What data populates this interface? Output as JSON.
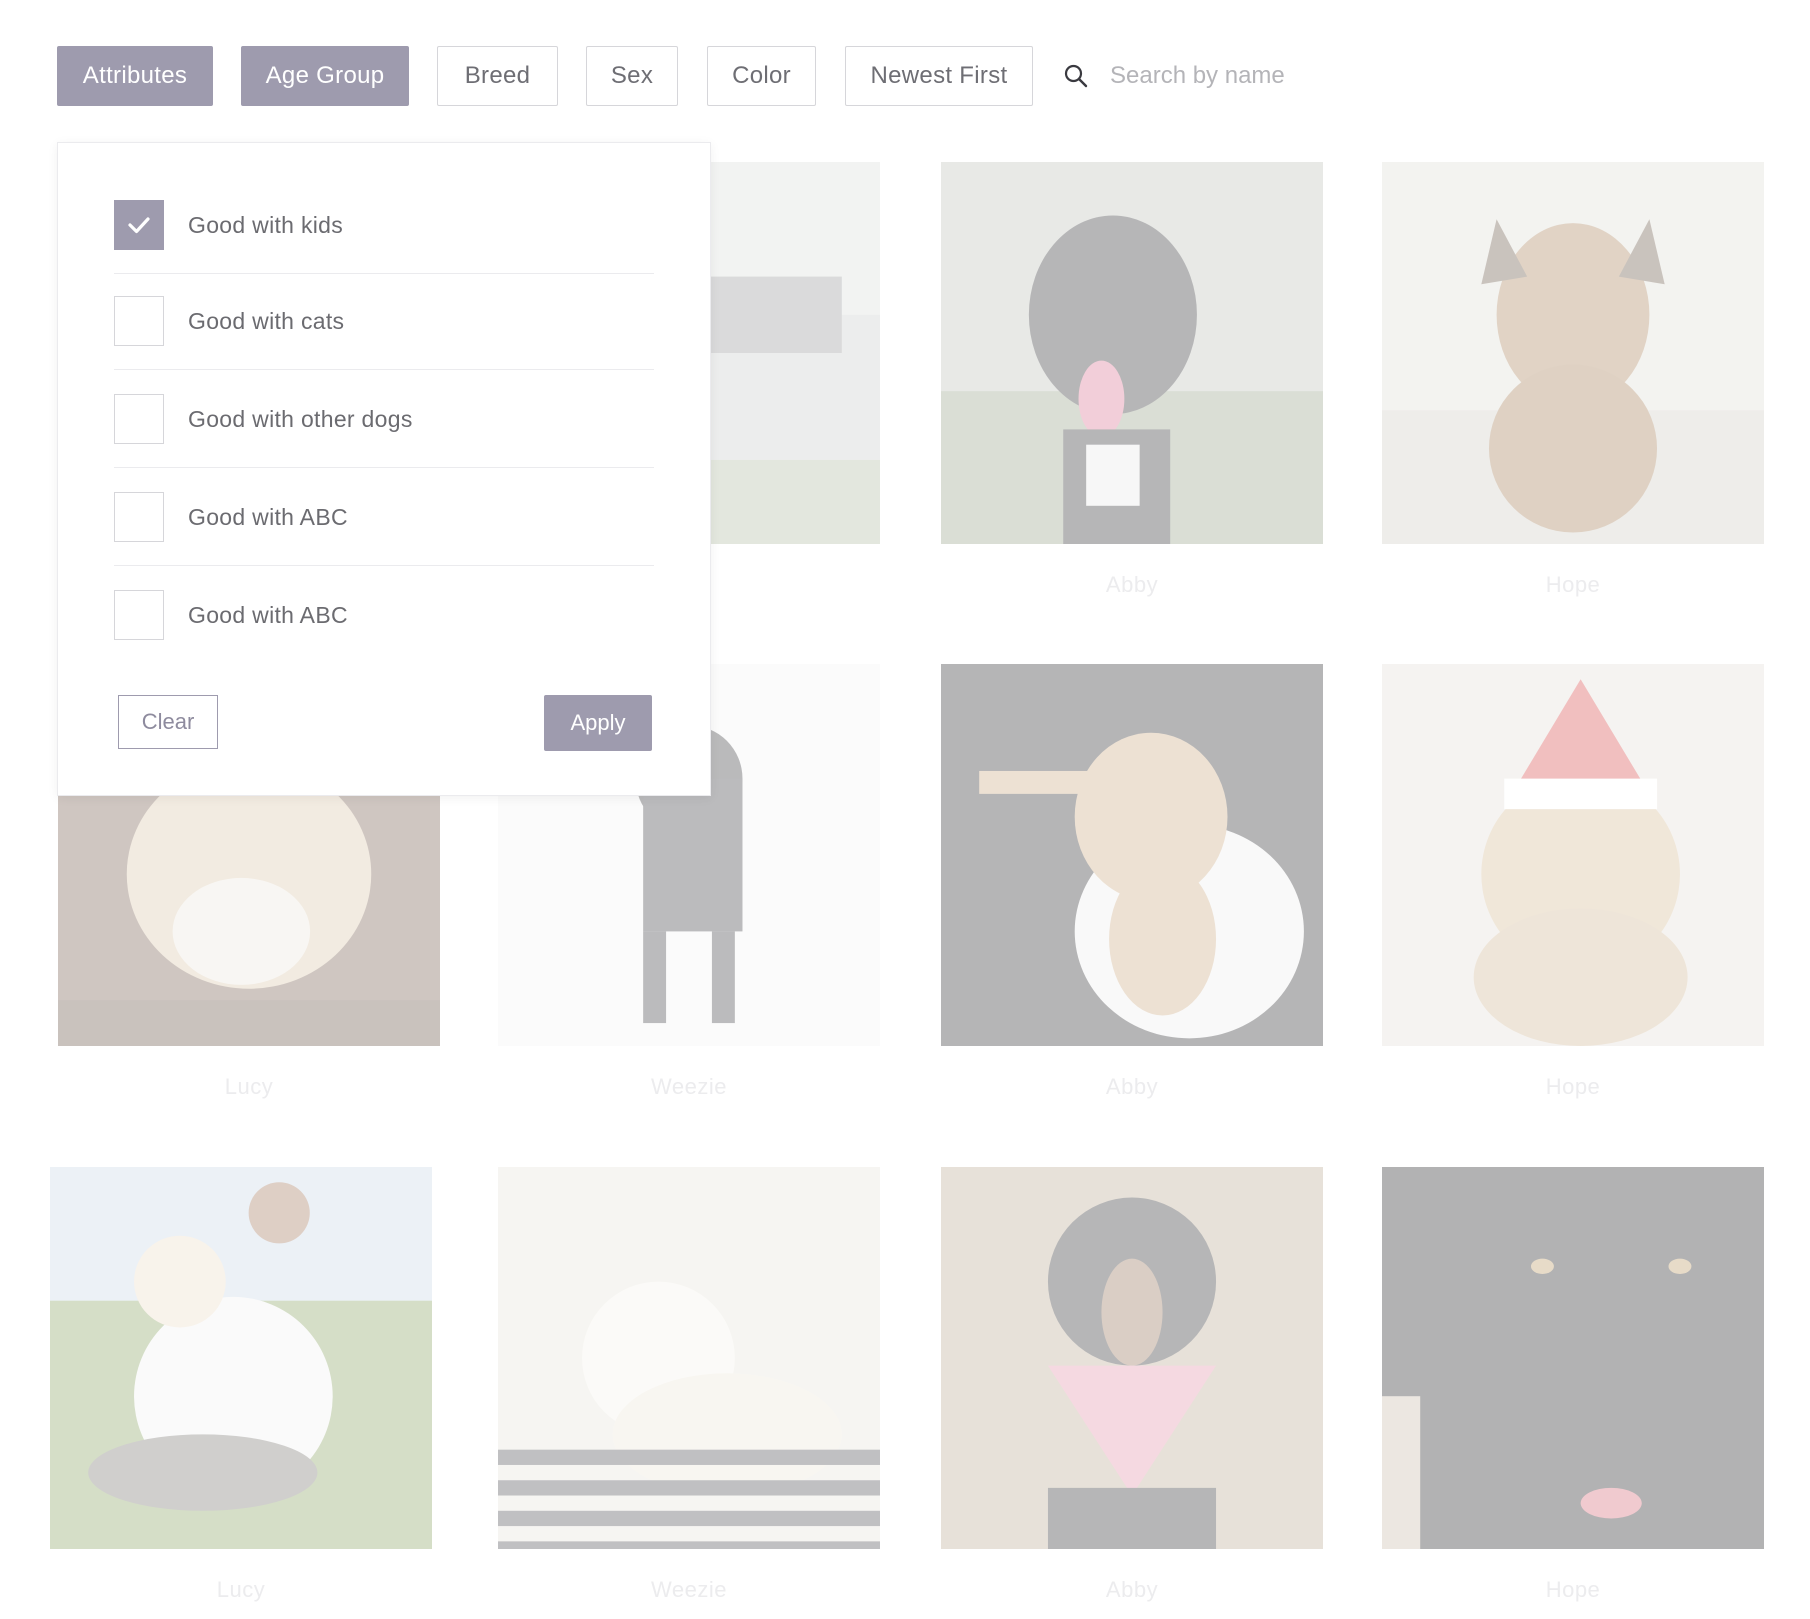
{
  "toolbar": {
    "filters": [
      {
        "label": "Attributes",
        "active": true
      },
      {
        "label": "Age Group",
        "active": true
      },
      {
        "label": "Breed",
        "active": false
      },
      {
        "label": "Sex",
        "active": false
      },
      {
        "label": "Color",
        "active": false
      },
      {
        "label": "Newest First",
        "active": false
      }
    ],
    "search": {
      "placeholder": "Search by name",
      "value": ""
    }
  },
  "attributes_dropdown": {
    "options": [
      {
        "label": "Good with kids",
        "checked": true
      },
      {
        "label": "Good with cats",
        "checked": false
      },
      {
        "label": "Good with other dogs",
        "checked": false
      },
      {
        "label": "Good with ABC",
        "checked": false
      },
      {
        "label": "Good with ABC",
        "checked": false
      }
    ],
    "clear_label": "Clear",
    "apply_label": "Apply"
  },
  "dogs": {
    "rows": [
      [
        {
          "name": ""
        },
        {
          "name": ""
        },
        {
          "name": "Abby"
        },
        {
          "name": "Hope"
        }
      ],
      [
        {
          "name": "Lucy"
        },
        {
          "name": "Weezie"
        },
        {
          "name": "Abby"
        },
        {
          "name": "Hope"
        }
      ],
      [
        {
          "name": "Lucy"
        },
        {
          "name": "Weezie"
        },
        {
          "name": "Abby"
        },
        {
          "name": "Hope"
        }
      ]
    ]
  },
  "colors": {
    "accent": "#9e9bae",
    "border": "#d6d6da",
    "text": "#6b6b70",
    "placeholder": "#b4b4b8"
  }
}
